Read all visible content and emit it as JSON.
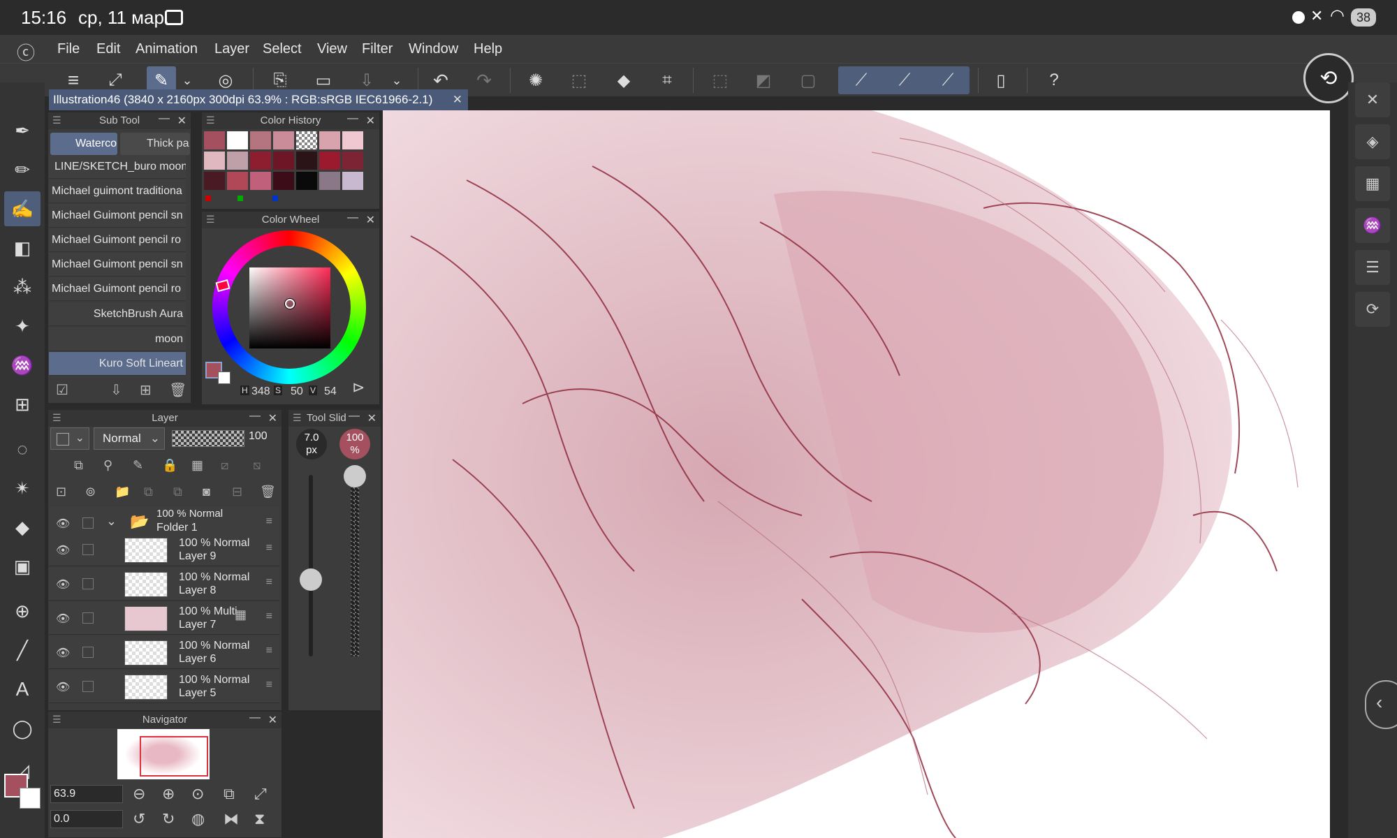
{
  "status_bar": {
    "time": "15:16",
    "date": "ср, 11 мар.",
    "battery": "38"
  },
  "menu": {
    "items": [
      "File",
      "Edit",
      "Animation",
      "Layer",
      "Select",
      "View",
      "Filter",
      "Window",
      "Help"
    ]
  },
  "document_tab": {
    "title": "Illustration46 (3840 x 2160px 300dpi 63.9% : RGB:sRGB IEC61966-2.1)"
  },
  "sub_tool": {
    "title": "Sub Tool",
    "tabs": [
      "Waterco",
      "Thick pa"
    ],
    "brushes": [
      "LINE/SKETCH_buro moon",
      "Michael guimont traditiona",
      "Michael Guimont pencil sn",
      "Michael Guimont pencil ro",
      "Michael Guimont pencil sn",
      "Michael Guimont pencil ro",
      "SketchBrush Aura",
      "moon",
      "Kuro Soft Lineart"
    ],
    "selected_index": 8
  },
  "color_history": {
    "title": "Color History",
    "swatches": [
      "#a5505e",
      "#ffffff",
      "#b47480",
      "#c98c98",
      "checker",
      "#d9a3ae",
      "#f0c8d2",
      "#e0b8c0",
      "#c0a0a8",
      "#8c1e30",
      "#6e1526",
      "#2a1418",
      "#9c1a2e",
      "#7c2434",
      "#4a1a24",
      "#b04858",
      "#c0607a",
      "#3c0c18",
      "#0a0a0a",
      "#8a7888",
      "#c8b8d0"
    ]
  },
  "color_wheel": {
    "title": "Color Wheel",
    "h_label": "H",
    "h": "348",
    "s_label": "S",
    "s": "50",
    "v_label": "V",
    "v": "54",
    "main_color": "#a5505e"
  },
  "layer_panel": {
    "title": "Layer",
    "blend_mode": "Normal",
    "opacity": "100",
    "folder": {
      "mode": "100 % Normal",
      "name": "Folder 1"
    },
    "layers": [
      {
        "mode": "100 % Normal",
        "name": "Layer 9"
      },
      {
        "mode": "100 % Normal",
        "name": "Layer 8"
      },
      {
        "mode": "100 % Multi",
        "name": "Layer 7"
      },
      {
        "mode": "100 % Normal",
        "name": "Layer 6"
      },
      {
        "mode": "100 % Normal",
        "name": "Layer 5"
      }
    ]
  },
  "tool_slider": {
    "title": "Tool Slid",
    "size": "7.0",
    "size_unit": "px",
    "opacity": "100",
    "opacity_unit": "%"
  },
  "navigator": {
    "title": "Navigator",
    "zoom": "63.9",
    "rotation": "0.0"
  },
  "icons": {
    "primary": "#a5505e",
    "accent": "#5b6c8c"
  }
}
